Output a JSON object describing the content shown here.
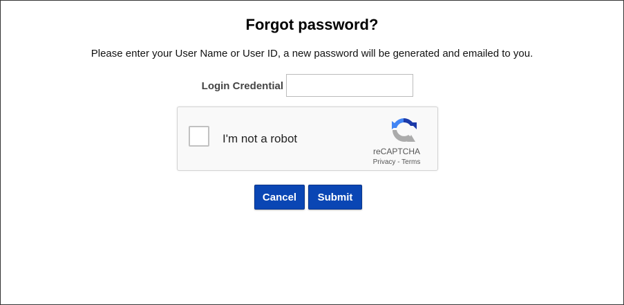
{
  "page": {
    "title": "Forgot password?",
    "instructions": "Please enter your User Name or User ID, a new password will be generated and emailed to you."
  },
  "form": {
    "credential_label": "Login Credential",
    "credential_value": "",
    "credential_placeholder": ""
  },
  "captcha": {
    "label": "I'm not a robot",
    "brand": "reCAPTCHA",
    "privacy_link": "Privacy",
    "separator": " - ",
    "terms_link": "Terms",
    "checked": false,
    "logo_icon": "recaptcha-logo-icon"
  },
  "buttons": {
    "cancel_label": "Cancel",
    "submit_label": "Submit"
  },
  "colors": {
    "button_bg": "#0a46b4",
    "button_text": "#ffffff",
    "captcha_bg": "#f9f9f9",
    "recaptcha_blue": "#1c3aa9",
    "recaptcha_light_blue": "#4285f4",
    "recaptcha_grey": "#ababab"
  }
}
